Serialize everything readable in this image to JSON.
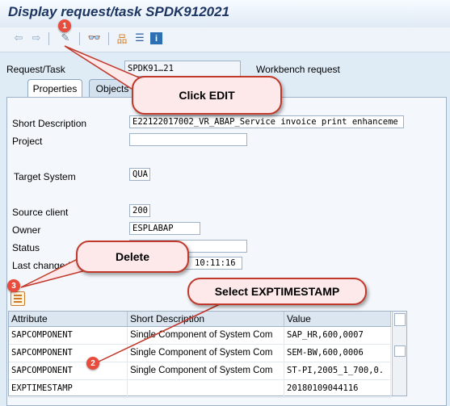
{
  "window": {
    "title": "Display request/task SPDK912021"
  },
  "toolbar": {
    "icons": [
      "back-arrow-icon",
      "forward-arrow-icon",
      "display-change-icon",
      "glasses-icon",
      "hierarchy-icon",
      "list-icon",
      "info-icon"
    ]
  },
  "header": {
    "request_label": "Request/Task",
    "request_value": "SPDK91…21",
    "request_type": "Workbench request"
  },
  "tabs": [
    {
      "label": "Properties",
      "active": true
    },
    {
      "label": "Objects",
      "active": false
    }
  ],
  "form": {
    "short_description": {
      "label": "Short Description",
      "value": "E22122017002_VR_ABAP_Service invoice print enhanceme"
    },
    "project": {
      "label": "Project",
      "value": ""
    },
    "target_system": {
      "label": "Target System",
      "value": "QUA"
    },
    "source_client": {
      "label": "Source client",
      "value": "200"
    },
    "owner": {
      "label": "Owner",
      "value": "ESPLABAP"
    },
    "status": {
      "label": "Status",
      "value": ""
    },
    "last_changed": {
      "label": "Last changed",
      "value": "10:11:16"
    }
  },
  "grid": {
    "headers": [
      "Attribute",
      "Short Description",
      "Value"
    ],
    "rows": [
      {
        "attribute": "SAPCOMPONENT",
        "description": "Single Component of System Com",
        "value": "SAP_HR,600,0007"
      },
      {
        "attribute": "SAPCOMPONENT",
        "description": "Single Component of System Com",
        "value": "SEM-BW,600,0006"
      },
      {
        "attribute": "SAPCOMPONENT",
        "description": "Single Component of System Com",
        "value": "ST-PI,2005_1_700,0."
      },
      {
        "attribute": "EXPTIMESTAMP",
        "description": "",
        "value": "20180109044116"
      }
    ]
  },
  "callouts": {
    "edit": "Click EDIT",
    "delete": "Delete",
    "select": "Select EXPTIMESTAMP"
  },
  "badges": {
    "one": "1",
    "two": "2",
    "three": "3"
  },
  "colors": {
    "callout_border": "#c0392b",
    "badge": "#e74c3c",
    "background": "#dfebf5",
    "title": "#1d3561"
  }
}
